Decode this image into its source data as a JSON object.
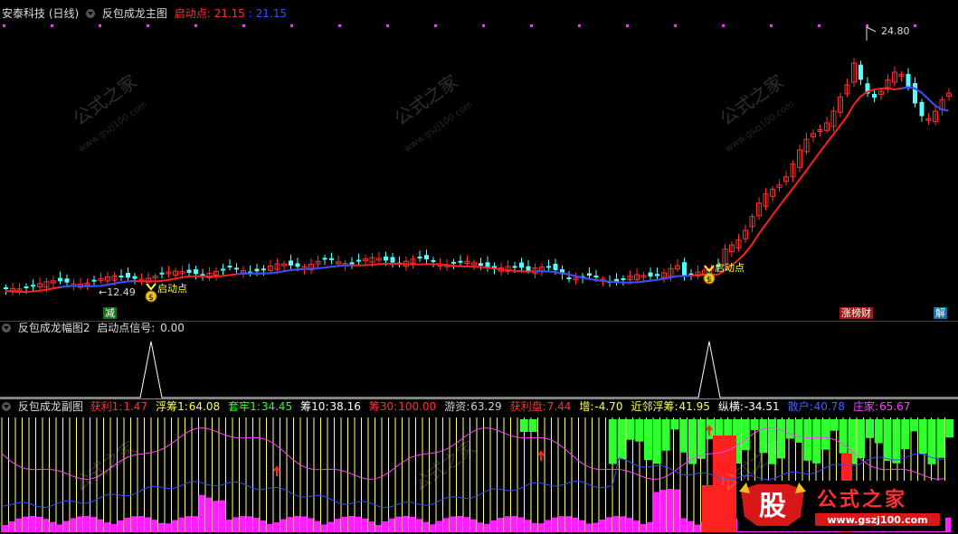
{
  "main": {
    "stock": "安泰科技 (日线)",
    "indicator": "反包成龙主图",
    "start_label": "启动点:",
    "start_value1": "21.15",
    "start_value2": ": 21.15",
    "high_label": "24.80",
    "low_label": "12.49",
    "signal_text1": "启动点",
    "signal_text2": "启动点",
    "tag_left": "减",
    "tag_mid": "涨榜财",
    "tag_right": "解"
  },
  "pane2": {
    "title": "反包成龙幅图2",
    "signal_label": "启动点信号:",
    "signal_value": "0.00"
  },
  "pane3": {
    "title": "反包成龙副图",
    "items": [
      {
        "label": "获利1:",
        "value": "1.47",
        "color": "#ff3030"
      },
      {
        "label": "浮筹1:",
        "value": "64.08",
        "color": "#ffff50"
      },
      {
        "label": "套牢1:",
        "value": "34.45",
        "color": "#30ff30"
      },
      {
        "label": "筹10:",
        "value": "38.16",
        "color": "#ffffff"
      },
      {
        "label": "筹30:",
        "value": "100.00",
        "color": "#ff3030"
      },
      {
        "label": "游资:",
        "value": "63.29",
        "color": "#d0d0d0"
      },
      {
        "label": "获利盘:",
        "value": "7.44",
        "color": "#ff3030"
      },
      {
        "label": "增:",
        "value": "-4.70",
        "color": "#ffff50"
      },
      {
        "label": "近邻浮筹:",
        "value": "41.95",
        "color": "#ffff50"
      },
      {
        "label": "纵横:",
        "value": "-34.51",
        "color": "#ffffff"
      },
      {
        "label": "散户:",
        "value": "40.78",
        "color": "#4060ff"
      },
      {
        "label": "庄家:",
        "value": "65.67",
        "color": "#ff40ff"
      }
    ]
  },
  "watermark": {
    "text_cn": "公式之家",
    "text_url": "www.gszj100.com"
  },
  "logo": {
    "glyph": "股",
    "brand": "公式之家",
    "url": "www.gszj100.com"
  },
  "colors": {
    "up": "#ff3030",
    "down": "#54ffff",
    "ma": "#ff2020",
    "ma_blue": "#3050ff",
    "signal": "#ffff40"
  }
}
